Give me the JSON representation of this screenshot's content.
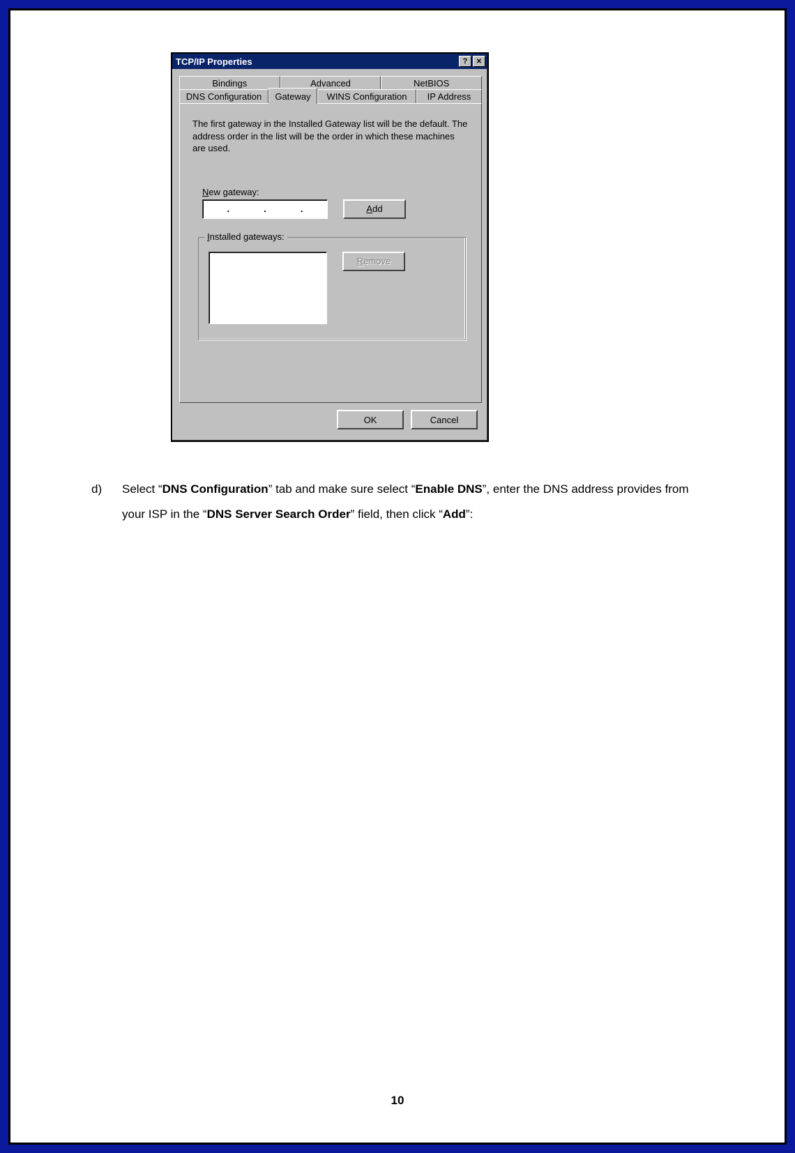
{
  "dialog": {
    "title": "TCP/IP Properties",
    "tabs_row1": [
      "Bindings",
      "Advanced",
      "NetBIOS"
    ],
    "tabs_row2": [
      "DNS Configuration",
      "Gateway",
      "WINS Configuration",
      "IP Address"
    ],
    "active_tab": "Gateway",
    "description": "The first gateway in the Installed Gateway list will be the default. The address order in the list will be the order in which these machines are used.",
    "new_gateway_label_u": "N",
    "new_gateway_label_rest": "ew gateway:",
    "add_btn_u": "A",
    "add_btn_rest": "dd",
    "installed_label_u": "I",
    "installed_label_rest": "nstalled gateways:",
    "remove_btn_u": "R",
    "remove_btn_rest": "emove",
    "ok_label": "OK",
    "cancel_label": "Cancel",
    "help_icon": "?",
    "close_icon": "✕"
  },
  "instruction": {
    "marker": "d)",
    "t1": "Select “",
    "b1": "DNS Configuration",
    "t2": "” tab and make sure select “",
    "b2": "Enable DNS",
    "t3": "”, enter the DNS address provides from your ISP in the “",
    "b3": "DNS Server Search Order",
    "t4": "” field, then click “",
    "b4": "Add",
    "t5": "”:"
  },
  "page_number": "10"
}
